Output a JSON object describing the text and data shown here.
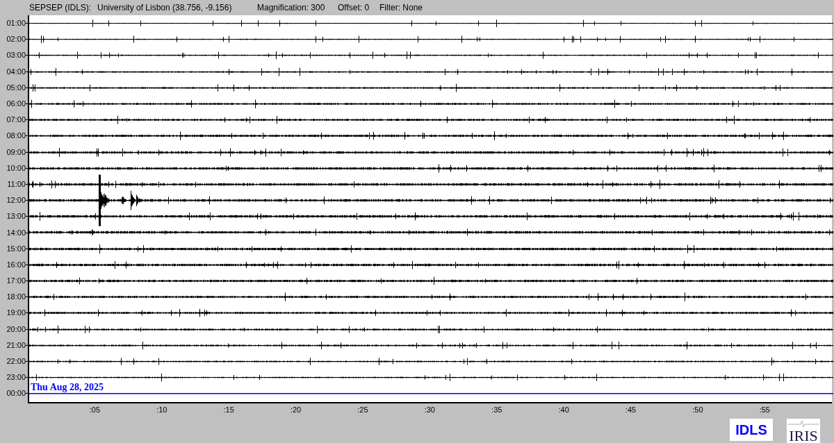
{
  "header": {
    "station": "SEPSEP (IDLS):",
    "location": "University of Lisbon (38.756, -9.156)",
    "magnification": "Magnification: 300",
    "offset": "Offset: 0",
    "filter": "Filter: None"
  },
  "rows": [
    {
      "time": "01:00",
      "kind": "past"
    },
    {
      "time": "02:00",
      "kind": "past"
    },
    {
      "time": "03:00",
      "kind": "past"
    },
    {
      "time": "04:00",
      "kind": "past"
    },
    {
      "time": "05:00",
      "kind": "past"
    },
    {
      "time": "06:00",
      "kind": "past"
    },
    {
      "time": "07:00",
      "kind": "past"
    },
    {
      "time": "08:00",
      "kind": "past"
    },
    {
      "time": "09:00",
      "kind": "past"
    },
    {
      "time": "10:00",
      "kind": "past"
    },
    {
      "time": "11:00",
      "kind": "past"
    },
    {
      "time": "12:00",
      "kind": "past"
    },
    {
      "time": "13:00",
      "kind": "past"
    },
    {
      "time": "14:00",
      "kind": "past"
    },
    {
      "time": "15:00",
      "kind": "past"
    },
    {
      "time": "16:00",
      "kind": "past"
    },
    {
      "time": "17:00",
      "kind": "past"
    },
    {
      "time": "18:00",
      "kind": "past"
    },
    {
      "time": "19:00",
      "kind": "past"
    },
    {
      "time": "20:00",
      "kind": "past"
    },
    {
      "time": "21:00",
      "kind": "past"
    },
    {
      "time": "22:00",
      "kind": "past"
    },
    {
      "time": "23:00",
      "kind": "past"
    },
    {
      "time": "00:00",
      "kind": "current"
    }
  ],
  "date_label": "Thu Aug 28, 2025",
  "minute_ticks": [
    ":05",
    ":10",
    ":15",
    ":20",
    ":25",
    ":30",
    ":35",
    ":40",
    ":45",
    ":50",
    ":55"
  ],
  "logos": {
    "network": "IDLS",
    "consortium": "IRIS"
  }
}
